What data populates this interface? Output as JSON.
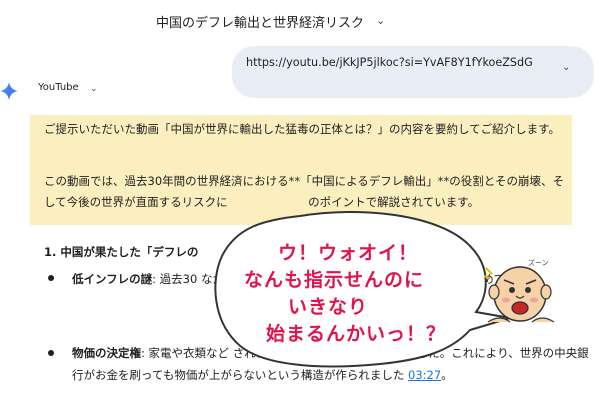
{
  "header": {
    "title": "中国のデフレ輸出と世界経済リスク"
  },
  "user_message": {
    "text": "https://youtu.be/jKkJP5jlkoc?si=YvAF8Y1fYkoeZSdG"
  },
  "model": {
    "name": "YouTube"
  },
  "summary": {
    "p1": "ご提示いただいた動画「中国が世界に輸出した猛毒の正体とは？」の内容を要約してご紹介します。",
    "p2": "この動画では、過去30年間の世界経済における**「中国によるデフレ輸出」**の役割とその崩壊、そして今後の世界が直面するリスクに　　　　　　　のポイントで解説されています。"
  },
  "section1": {
    "heading": "1. 中国が果たした「デフレの",
    "bullet1": {
      "term": "低インフレの謎",
      "text": ": 過去30                                                        なかったのは、2001年のWT                                                        を世界に供給し続けたためで"
    },
    "bullet2": {
      "term": "物価の決定権",
      "text": ": 家電や衣類など                                           され、物価の決定権が中国に移りました。これにより、世界の中央銀行がお金を刷っても物価が上がらないという構造が作られました ",
      "link": "03:27",
      "end": "。"
    }
  },
  "overlay": {
    "line1": "ウ！ウォオイ！",
    "line2": "なんも指示せんのに",
    "line3": "いきなり",
    "line4": "始まるんかいっ！？",
    "char_label": "ズーン"
  },
  "colors": {
    "summary_bg": "#fcefbf",
    "user_bubble_bg": "#e9eef6",
    "overlay_text": "#e0144a",
    "link": "#1a73e8"
  }
}
